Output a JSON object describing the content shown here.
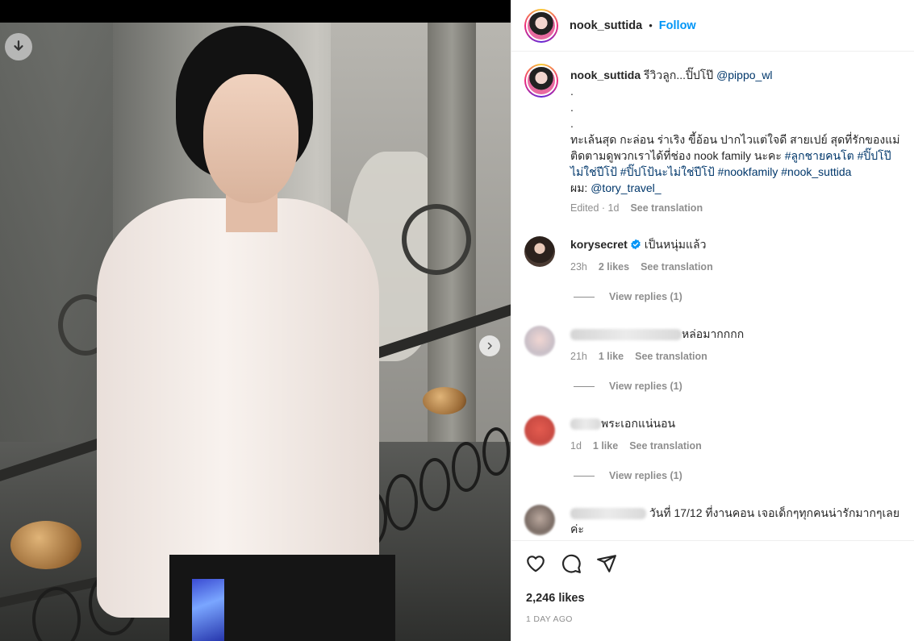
{
  "post": {
    "username": "nook_suttida",
    "separator": "•",
    "follow_label": "Follow",
    "caption": {
      "text_start": "รีวิวลูก...ปิ๊ปโป๊ ",
      "mention": "@pippo_wl",
      "dots": [
        ".",
        ".",
        "."
      ],
      "line1": "ทะเล้นสุด กะล่อน ร่าเริง ขี้อ้อน ปากไวแต่ใจดี สายเปย์ สุดที่รักของแม่",
      "line2_text": "ติดตามดูพวกเราได้ที่ช่อง nook family นะคะ ",
      "tags_line2": [
        "#ลูกชายคนโต",
        "#ปิ๊ปโป๊"
      ],
      "tags_line3": [
        "ไม่ใช่ปีโป้",
        "#ปิ๊ปโป้นะไม่ใช่ปีโป้",
        "#nookfamily",
        "#nook_suttida"
      ],
      "hair_prefix": "ผม: ",
      "hair_mention": "@tory_travel_",
      "edited": "Edited · 1d",
      "see_translation": "See translation"
    },
    "likes": "2,246 likes",
    "date": "1 DAY AGO"
  },
  "comments": [
    {
      "username": "korysecret",
      "verified": true,
      "text": "เป็นหนุ่มแล้ว",
      "time": "23h",
      "likes": "2 likes",
      "translate": "See translation",
      "replies": "View replies (1)"
    },
    {
      "username": "",
      "text": "หล่อมากกกก",
      "time": "21h",
      "likes": "1 like",
      "translate": "See translation",
      "replies": "View replies (1)"
    },
    {
      "username": "",
      "text": "พระเอกแน่นอน",
      "time": "1d",
      "likes": "1 like",
      "translate": "See translation",
      "replies": "View replies (1)"
    },
    {
      "username": "",
      "text": "วันที่ 17/12 ที่งานคอน เจอเด็กๆทุกคนน่ารักมากๆเลย",
      "text2": "ค่ะ"
    }
  ],
  "icons": {
    "download": "download-arrow-icon",
    "next": "chevron-right-icon",
    "like": "heart-icon",
    "comment": "comment-bubble-icon",
    "share": "paper-plane-icon",
    "verified": "verified-badge-icon"
  },
  "colors": {
    "follow": "#0095f6",
    "link": "#00376b",
    "muted": "#8e8e8e",
    "text": "#262626",
    "verified": "#0095f6"
  }
}
